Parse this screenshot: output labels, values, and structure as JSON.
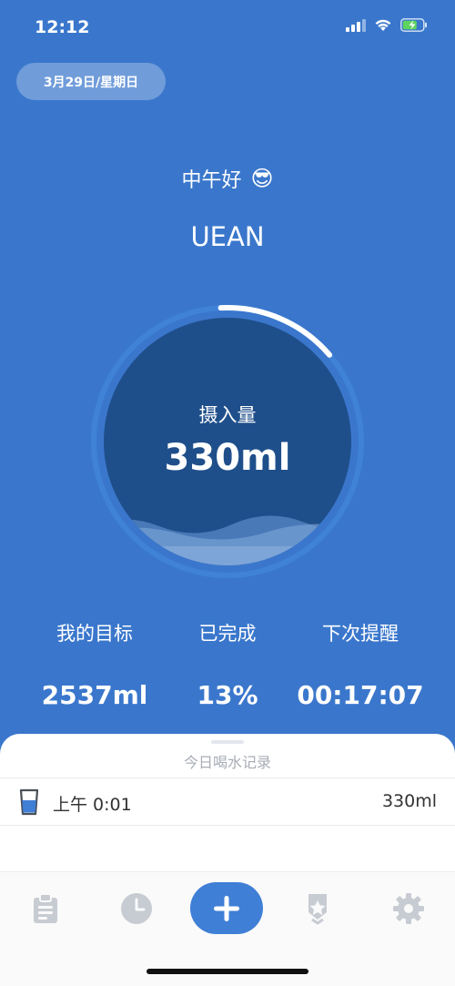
{
  "status_bar": {
    "time": "12:12"
  },
  "header": {
    "date": "3月29日/星期日",
    "greeting": "中午好",
    "greeting_emoji": "😎",
    "username": "UEAN"
  },
  "gauge": {
    "label": "摄入量",
    "value": "330ml",
    "progress_fraction": 0.13
  },
  "stats": [
    {
      "label": "我的目标",
      "value": "2537ml"
    },
    {
      "label": "已完成",
      "value": "13%"
    },
    {
      "label": "下次提醒",
      "value": "00:17:07"
    }
  ],
  "records": {
    "title": "今日喝水记录",
    "items": [
      {
        "time": "上午 0:01",
        "amount": "330ml"
      }
    ]
  },
  "tabbar": {
    "tabs": [
      {
        "name": "tab-records",
        "icon": "clipboard-icon"
      },
      {
        "name": "tab-history",
        "icon": "clock-icon"
      },
      {
        "name": "tab-add",
        "icon": "plus-icon"
      },
      {
        "name": "tab-achievements",
        "icon": "star-badge-icon"
      },
      {
        "name": "tab-settings",
        "icon": "gear-icon"
      }
    ]
  },
  "colors": {
    "background": "#3a77cc",
    "gauge_inner": "#1f4f8b",
    "accent": "#3f7fd6",
    "tab_icon": "#c7cbd2"
  }
}
